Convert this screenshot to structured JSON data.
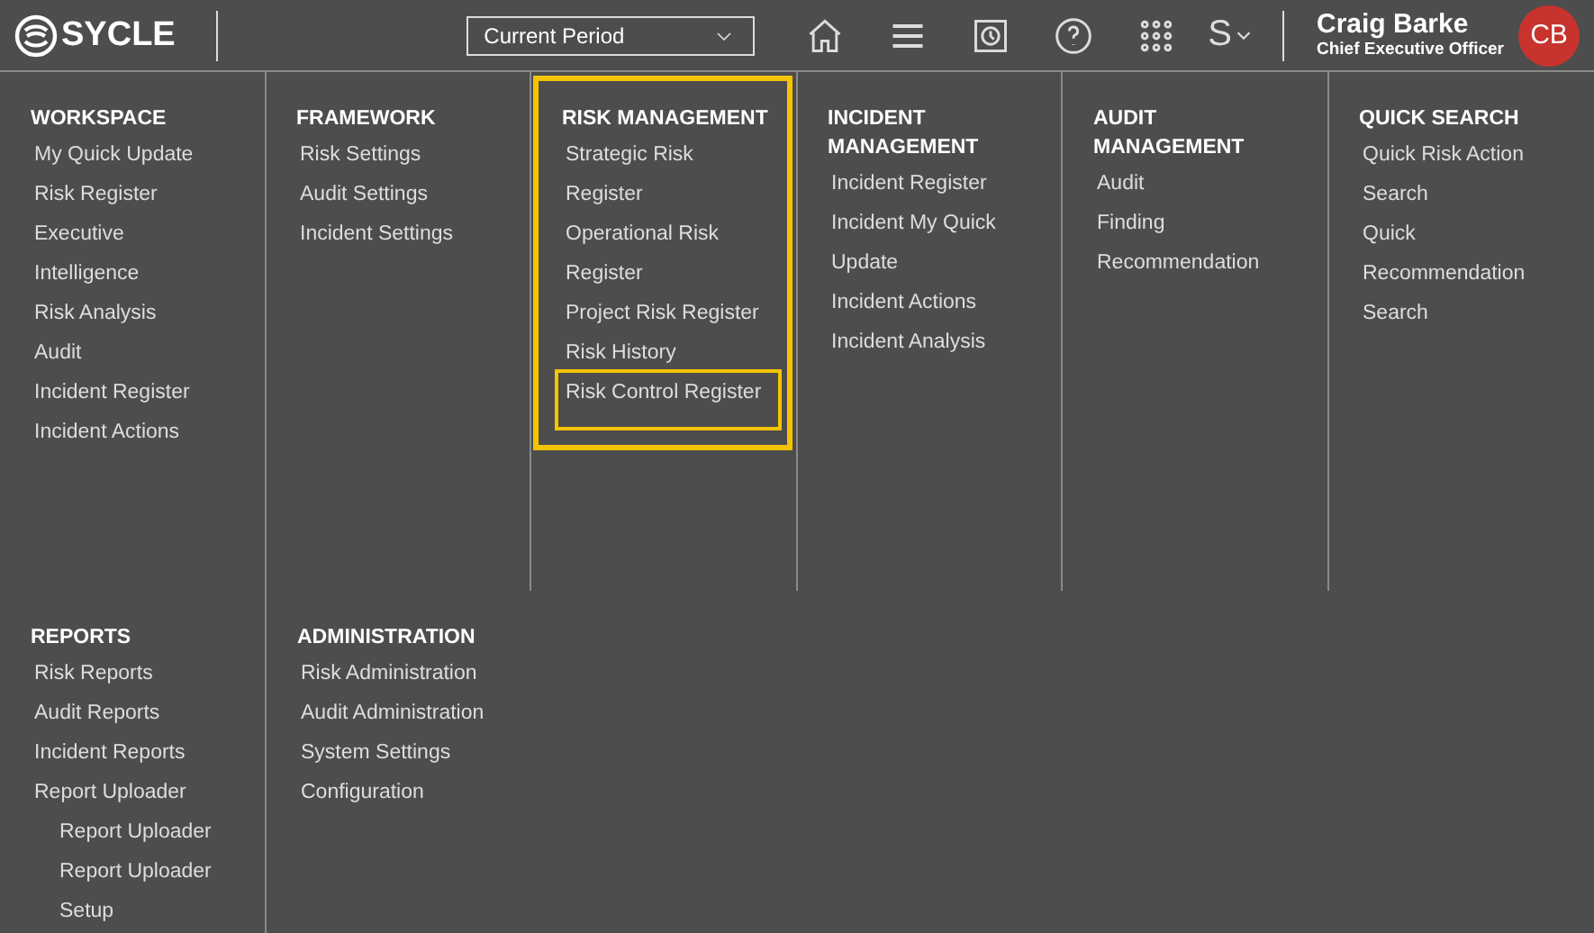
{
  "header": {
    "logo": "SYCLE",
    "period_select": {
      "value": "Current Period"
    },
    "language_button": "S",
    "user": {
      "name": "Craig Barke",
      "role": "Chief Executive Officer",
      "initials": "CB"
    }
  },
  "menu_sections": [
    {
      "title": "WORKSPACE",
      "highlighted": false,
      "items": [
        {
          "label": "My Quick Update",
          "highlighted": false
        },
        {
          "label": "Risk Register",
          "highlighted": false
        },
        {
          "label": "Executive",
          "highlighted": false
        },
        {
          "label": "Intelligence",
          "highlighted": false
        },
        {
          "label": "Risk Analysis",
          "highlighted": false
        },
        {
          "label": "Audit",
          "highlighted": false
        },
        {
          "label": "Incident Register",
          "highlighted": false
        },
        {
          "label": "Incident Actions",
          "highlighted": false
        }
      ]
    },
    {
      "title": "FRAMEWORK",
      "highlighted": false,
      "items": [
        {
          "label": "Risk Settings",
          "highlighted": false
        },
        {
          "label": "Audit Settings",
          "highlighted": false
        },
        {
          "label": "Incident Settings",
          "highlighted": false
        }
      ]
    },
    {
      "title": "RISK MANAGEMENT",
      "highlighted": true,
      "items": [
        {
          "label": "Strategic Risk Register",
          "highlighted": false
        },
        {
          "label": "Operational Risk Register",
          "highlighted": false
        },
        {
          "label": "Project Risk Register",
          "highlighted": false
        },
        {
          "label": "Risk History",
          "highlighted": false
        },
        {
          "label": "Risk Control Register",
          "highlighted": true
        }
      ]
    },
    {
      "title": "INCIDENT MANAGEMENT",
      "highlighted": false,
      "items": [
        {
          "label": "Incident Register",
          "highlighted": false
        },
        {
          "label": "Incident My Quick Update",
          "highlighted": false
        },
        {
          "label": "Incident Actions",
          "highlighted": false
        },
        {
          "label": "Incident Analysis",
          "highlighted": false
        }
      ]
    },
    {
      "title": "AUDIT MANAGEMENT",
      "highlighted": false,
      "items": [
        {
          "label": "Audit",
          "highlighted": false
        },
        {
          "label": "Finding",
          "highlighted": false
        },
        {
          "label": "Recommendation",
          "highlighted": false
        }
      ]
    },
    {
      "title": "QUICK SEARCH",
      "highlighted": false,
      "items": [
        {
          "label": "Quick Risk Action Search",
          "highlighted": false
        },
        {
          "label": "Quick Recommendation Search",
          "highlighted": false
        }
      ]
    },
    {
      "title": "REPORTS",
      "highlighted": false,
      "items": [
        {
          "label": "Risk Reports",
          "highlighted": false
        },
        {
          "label": "Audit Reports",
          "highlighted": false
        },
        {
          "label": "Incident Reports",
          "highlighted": false
        },
        {
          "label": "Report Uploader",
          "highlighted": false,
          "children": [
            {
              "label": "Report Uploader",
              "highlighted": false
            },
            {
              "label": "Report Uploader Setup",
              "highlighted": false
            }
          ]
        }
      ]
    },
    {
      "title": "ADMINISTRATION",
      "highlighted": false,
      "items": [
        {
          "label": "Risk Administration",
          "highlighted": false
        },
        {
          "label": "Audit Administration",
          "highlighted": false
        },
        {
          "label": "System Settings",
          "highlighted": false
        },
        {
          "label": "Configuration",
          "highlighted": false
        }
      ]
    }
  ]
}
